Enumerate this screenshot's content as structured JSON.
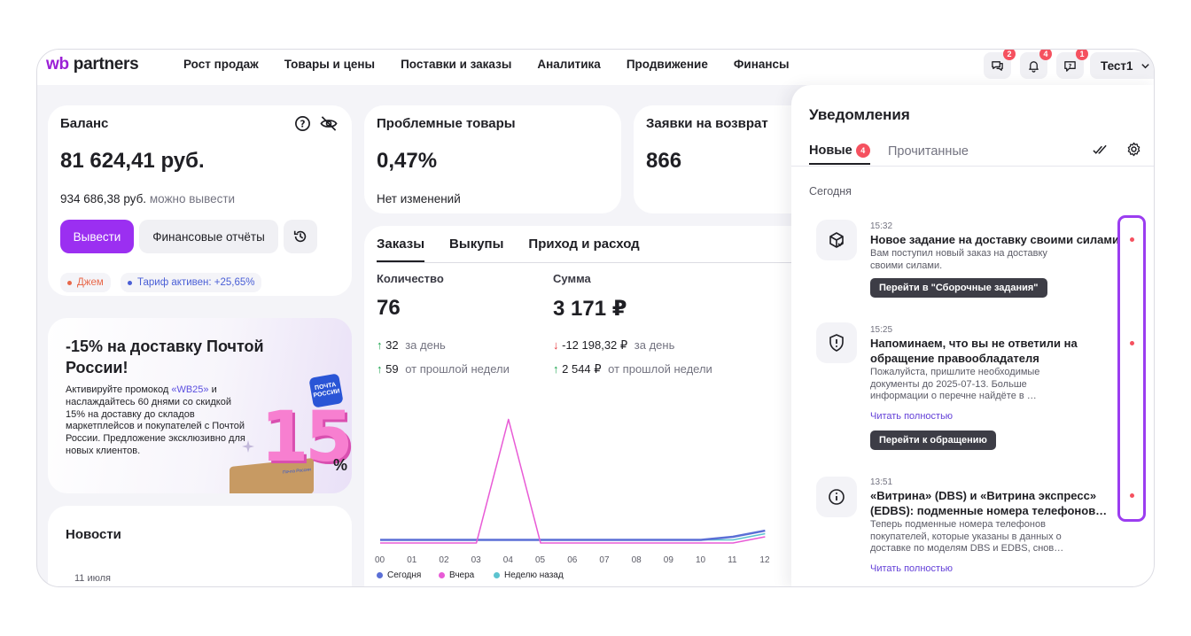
{
  "header": {
    "logo_wb": "wb",
    "logo_rest": " partners",
    "nav": [
      "Рост продаж",
      "Товары и цены",
      "Поставки и заказы",
      "Аналитика",
      "Продвижение",
      "Финансы"
    ],
    "icons": [
      {
        "name": "chat-icon",
        "badge": "2"
      },
      {
        "name": "bell-icon",
        "badge": "4"
      },
      {
        "name": "support-icon",
        "badge": "1"
      }
    ],
    "user": "Тест1"
  },
  "balance": {
    "title": "Баланс",
    "amount": "81 624,41 руб.",
    "withdrawable_value": "934 686,38 руб.",
    "withdrawable_label": "можно вывести",
    "withdraw_button": "Вывести",
    "reports_button": "Финансовые отчёты",
    "pill_jam": "Джем",
    "pill_tariff": "Тариф активен: +25,65%"
  },
  "problem_goods": {
    "title": "Проблемные товары",
    "value": "0,47%",
    "note": "Нет изменений"
  },
  "returns": {
    "title": "Заявки на возврат",
    "value": "866"
  },
  "promo": {
    "title": "-15% на доставку Почтой России!",
    "text_before": "Активируйте промокод ",
    "code": "«WB25»",
    "text_after": " и наслаждайтесь 60 днями со скидкой 15% на доставку до складов маркетплейсов и покупателей с Почтой России. Предложение эксклюзивно для новых клиентов.",
    "badge_text": "ПОЧТА РОССИИ",
    "big_text": "15",
    "percent": "%",
    "box_text": "Почта России"
  },
  "news": {
    "title": "Новости",
    "date": "11 июля"
  },
  "orders": {
    "tabs": [
      "Заказы",
      "Выкупы",
      "Приход и расход"
    ],
    "quantity_label": "Количество",
    "quantity_value": "76",
    "q_day_value": "32",
    "q_day_label": "за день",
    "q_week_value": "59",
    "q_week_label": "от прошлой недели",
    "sum_label": "Сумма",
    "sum_value": "3 171 ₽",
    "s_day_value": "-12 198,32 ₽",
    "s_day_label": "за день",
    "s_week_value": "2 544 ₽",
    "s_week_label": "от прошлой недели"
  },
  "chart_data": {
    "type": "line",
    "x": [
      "00",
      "01",
      "02",
      "03",
      "04",
      "05",
      "06",
      "07",
      "08",
      "09",
      "10",
      "11",
      "12"
    ],
    "series": [
      {
        "name": "Сегодня",
        "color": "#5b6fd6",
        "values": [
          1,
          1,
          1,
          1,
          1,
          1,
          1,
          1,
          1,
          1,
          1,
          2,
          4
        ]
      },
      {
        "name": "Вчера",
        "color": "#e85bd6",
        "values": [
          0,
          0,
          0,
          0,
          40,
          0,
          0,
          0,
          0,
          0,
          0,
          0,
          2
        ]
      },
      {
        "name": "Неделю назад",
        "color": "#5cc3cf",
        "values": [
          1,
          1,
          1,
          1,
          1,
          1,
          1,
          1,
          1,
          1,
          1,
          1,
          3
        ]
      }
    ],
    "ylim": [
      0,
      45
    ],
    "grid": false,
    "legend": "bottom"
  },
  "notifications": {
    "title": "Уведомления",
    "tab_new": "Новые",
    "tab_new_count": "4",
    "tab_read": "Прочитанные",
    "section": "Сегодня",
    "items": [
      {
        "icon": "package-icon",
        "time": "15:32",
        "title": "Новое задание на доставку своими силами",
        "body": "Вам поступил новый заказ на доставку своими силами.",
        "button": "Перейти в \"Сборочные задания\""
      },
      {
        "icon": "shield-alert-icon",
        "time": "15:25",
        "title": "Напоминаем, что вы не ответили на обращение правообладателя",
        "body": "Пожалуйста, пришлите необходимые документы до 2025-07-13. Больше информации о перечне найдёте в …",
        "link": "Читать полностью",
        "button": "Перейти к обращению"
      },
      {
        "icon": "info-icon",
        "time": "13:51",
        "title": "«Витрина» (DBS) и «Витрина экспресс» (EDBS): подменные номера телефонов…",
        "body": "Теперь подменные номера телефонов покупателей, которые указаны в данных о доставке по моделям DBS и EDBS, снов…",
        "link": "Читать полностью"
      }
    ]
  }
}
